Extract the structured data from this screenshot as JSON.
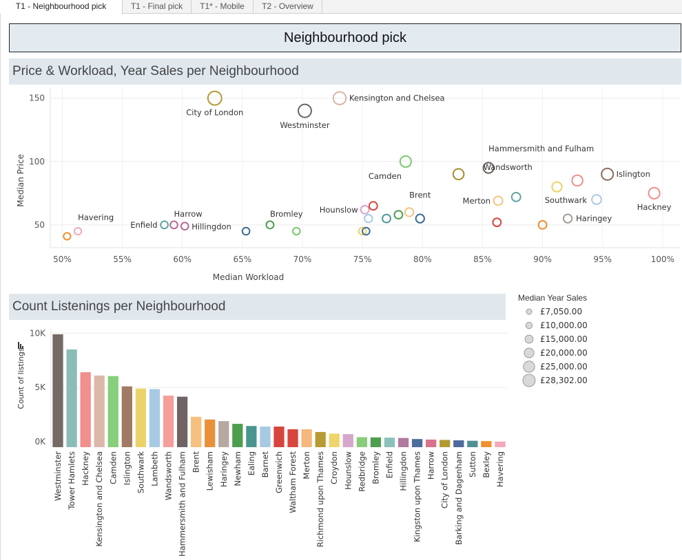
{
  "tabs": [
    {
      "label": "T1 - Neighbourhood pick",
      "active": true
    },
    {
      "label": "T1 - Final pick",
      "active": false
    },
    {
      "label": "T1* - Mobile",
      "active": false
    },
    {
      "label": "T2 - Overview",
      "active": false
    }
  ],
  "dashboard": {
    "title": "Neighbourhood pick"
  },
  "scatter_section": {
    "title": "Price & Workload, Year Sales per Neighbourhood"
  },
  "bar_section": {
    "title": "Count Listenings per Neighbourhood"
  },
  "legend": {
    "title": "Median Year Sales",
    "items": [
      "£7,050.00",
      "£10,000.00",
      "£15,000.00",
      "£20,000.00",
      "£25,000.00",
      "£28,302.00"
    ],
    "values": [
      7050,
      10000,
      15000,
      20000,
      25000,
      28302
    ]
  },
  "chart_data": [
    {
      "type": "scatter",
      "title": "Price & Workload, Year Sales per Neighbourhood",
      "xlabel": "Median Workload",
      "ylabel": "Median Price",
      "xlim": [
        49,
        101.5
      ],
      "ylim": [
        32,
        158
      ],
      "xticks": [
        50,
        55,
        60,
        65,
        70,
        75,
        80,
        85,
        90,
        95,
        100
      ],
      "yticks": [
        50,
        100,
        150
      ],
      "xtick_labels": [
        "50%",
        "55%",
        "60%",
        "65%",
        "70%",
        "75%",
        "80%",
        "85%",
        "90%",
        "95%",
        "100%"
      ],
      "ytick_labels": [
        "50",
        "100",
        "150"
      ],
      "grid": true,
      "size_field": "Median Year Sales",
      "points": [
        {
          "name": "City of London",
          "label": "City of London",
          "x": 62.7,
          "y": 150,
          "sales": 28000,
          "color": "#b39a2f"
        },
        {
          "name": "Westminster",
          "label": "Westminster",
          "x": 70.2,
          "y": 140,
          "sales": 26000,
          "color": "#6b6262"
        },
        {
          "name": "Kensington and Chelsea",
          "label": "Kensington and Chelsea",
          "x": 73.1,
          "y": 150,
          "sales": 25000,
          "color": "#d6b6a8"
        },
        {
          "name": "Camden",
          "label": "Camden",
          "x": 78.6,
          "y": 100,
          "sales": 20000,
          "color": "#7cc76f"
        },
        {
          "name": "Hammersmith and Fulham",
          "label": "Hammersmith and Fulham",
          "x": 85.5,
          "y": 95,
          "sales": 18000,
          "color": "#6a5f5c"
        },
        {
          "name": "Wandsworth",
          "label": "Wandsworth",
          "x": 83.0,
          "y": 90,
          "sales": 19000,
          "color": "#a58d2e"
        },
        {
          "name": "Islington",
          "label": "Islington",
          "x": 95.4,
          "y": 90,
          "sales": 22000,
          "color": "#8b6b5a"
        },
        {
          "name": "Hackney",
          "label": "Hackney",
          "x": 99.3,
          "y": 75,
          "sales": 20000,
          "color": "#f28e8b"
        },
        {
          "name": "Southwark_pt",
          "label": "",
          "x": 91.2,
          "y": 80,
          "sales": 16000,
          "color": "#edd35f"
        },
        {
          "name": "Tower Hamlets",
          "label": "",
          "x": 92.9,
          "y": 85,
          "sales": 19000,
          "color": "#f28e8b"
        },
        {
          "name": "Southwark",
          "label": "Southwark",
          "x": 94.5,
          "y": 70,
          "sales": 15000,
          "color": "#a7c9e6"
        },
        {
          "name": "Lambeth",
          "label": "",
          "x": 87.8,
          "y": 72,
          "sales": 13000,
          "color": "#5fa5a0"
        },
        {
          "name": "Merton",
          "label": "Merton",
          "x": 86.3,
          "y": 69,
          "sales": 13000,
          "color": "#f7c37e"
        },
        {
          "name": "Haringey",
          "label": "Haringey",
          "x": 92.1,
          "y": 55,
          "sales": 12000,
          "color": "#a39d96"
        },
        {
          "name": "Barnet",
          "label": "",
          "x": 90.0,
          "y": 50,
          "sales": 11000,
          "color": "#f08b2c"
        },
        {
          "name": "Newham",
          "label": "",
          "x": 86.2,
          "y": 52,
          "sales": 11000,
          "color": "#d9443f"
        },
        {
          "name": "Brent",
          "label": "Brent",
          "x": 78.9,
          "y": 60,
          "sales": 12000,
          "color": "#f7c37e"
        },
        {
          "name": "Greenwich",
          "label": "",
          "x": 79.8,
          "y": 55,
          "sales": 12000,
          "color": "#3a6c95"
        },
        {
          "name": "Ealing",
          "label": "",
          "x": 78.0,
          "y": 58,
          "sales": 11000,
          "color": "#4e9e52"
        },
        {
          "name": "Waltham Forest",
          "label": "",
          "x": 77.0,
          "y": 55,
          "sales": 11000,
          "color": "#4e9a96"
        },
        {
          "name": "Hounslow",
          "label": "Hounslow",
          "x": 75.2,
          "y": 62,
          "sales": 11000,
          "color": "#d5a6c9"
        },
        {
          "name": "Lewisham",
          "label": "",
          "x": 75.9,
          "y": 65,
          "sales": 11000,
          "color": "#d9443f"
        },
        {
          "name": "Redbridge",
          "label": "",
          "x": 75.5,
          "y": 55,
          "sales": 10000,
          "color": "#a7c9e6"
        },
        {
          "name": "Croydon",
          "label": "",
          "x": 75.0,
          "y": 45,
          "sales": 8500,
          "color": "#edd35f"
        },
        {
          "name": "Kingston upon Thames",
          "label": "",
          "x": 75.3,
          "y": 45,
          "sales": 8500,
          "color": "#3e6d9c"
        },
        {
          "name": "Bromley",
          "label": "Bromley",
          "x": 67.3,
          "y": 50,
          "sales": 9000,
          "color": "#4e9e52"
        },
        {
          "name": "Sutton",
          "label": "",
          "x": 69.5,
          "y": 45,
          "sales": 8000,
          "color": "#7cc76f"
        },
        {
          "name": "Barking and Dagenham",
          "label": "",
          "x": 65.3,
          "y": 45,
          "sales": 8500,
          "color": "#3a6c95"
        },
        {
          "name": "Harrow",
          "label": "Harrow",
          "x": 59.3,
          "y": 50,
          "sales": 8500,
          "color": "#b56a98"
        },
        {
          "name": "Hillingdon",
          "label": "Hillingdon",
          "x": 60.2,
          "y": 49,
          "sales": 8500,
          "color": "#b56a98"
        },
        {
          "name": "Enfield",
          "label": "Enfield",
          "x": 58.5,
          "y": 50,
          "sales": 8500,
          "color": "#5fa5a0"
        },
        {
          "name": "Havering",
          "label": "Havering",
          "x": 51.3,
          "y": 45,
          "sales": 7500,
          "color": "#f4a8b8"
        },
        {
          "name": "Bexley",
          "label": "",
          "x": 50.4,
          "y": 41,
          "sales": 7500,
          "color": "#f08b2c"
        }
      ]
    },
    {
      "type": "bar",
      "title": "Count Listenings per Neighbourhood",
      "ylabel": "Count of listings",
      "ylim": [
        -500,
        10400
      ],
      "yticks": [
        0,
        5000,
        10000
      ],
      "ytick_labels": [
        "0K",
        "5K",
        "10K"
      ],
      "categories": [
        "Westminster",
        "Tower Hamlets",
        "Hackney",
        "Kensington and Chelsea",
        "Camden",
        "Islington",
        "Southwark",
        "Lambeth",
        "Wandsworth",
        "Hammersmith and Fulham",
        "Brent",
        "Lewisham",
        "Haringey",
        "Newham",
        "Ealing",
        "Barnet",
        "Greenwich",
        "Waltham Forest",
        "Merton",
        "Richmond upon Thames",
        "Croydon",
        "Hounslow",
        "Redbridge",
        "Bromley",
        "Enfield",
        "Hillingdon",
        "Kingston upon Thames",
        "Harrow",
        "City of London",
        "Barking and Dagenham",
        "Sutton",
        "Bexley",
        "Havering"
      ],
      "values": [
        9900,
        8500,
        6400,
        6100,
        6050,
        5100,
        4900,
        4850,
        4250,
        4150,
        2300,
        2050,
        1900,
        1650,
        1450,
        1400,
        1400,
        1150,
        1150,
        900,
        750,
        700,
        420,
        400,
        380,
        350,
        250,
        200,
        170,
        130,
        90,
        60,
        10
      ],
      "colors": [
        "#766a66",
        "#8bbcb8",
        "#f28e8b",
        "#dbb8aa",
        "#87cf7b",
        "#a07a64",
        "#ecd26a",
        "#a8c9e3",
        "#f59f9b",
        "#6f6463",
        "#f6c07e",
        "#e8913a",
        "#b7a9a2",
        "#4d9e4d",
        "#4b958f",
        "#a7c9e3",
        "#d6453d",
        "#d9453f",
        "#f5b77b",
        "#b79a32",
        "#efd46c",
        "#d6a6cb",
        "#88cc7c",
        "#4f9e50",
        "#8cc0bb",
        "#b07aa0",
        "#4d6b9c",
        "#d9728b",
        "#b19a30",
        "#4d6b9c",
        "#4f8f95",
        "#ef912f",
        "#f5a9bc"
      ]
    }
  ]
}
